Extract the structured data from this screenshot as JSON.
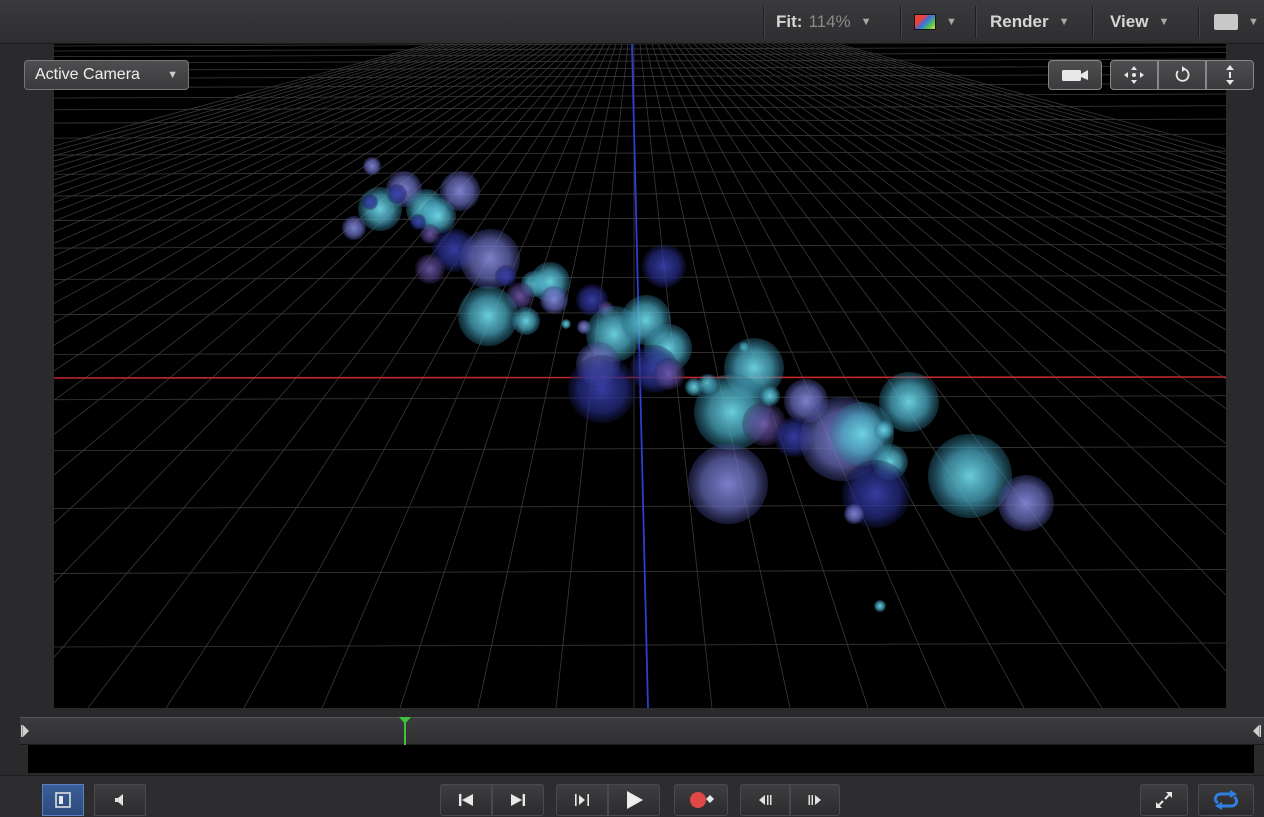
{
  "toolbar": {
    "fit_label": "Fit:",
    "fit_value": "114%",
    "render_label": "Render",
    "view_label": "View",
    "color_swatch_icon": "color-channels-icon",
    "layout_icon": "layout-icon"
  },
  "canvas": {
    "camera_select": "Active Camera",
    "camera_tools": [
      "camera-icon",
      "pan-icon",
      "orbit-icon",
      "dolly-icon"
    ],
    "axis_colors": {
      "x_axis": "#c0282a",
      "y_axis": "#2c3fd0",
      "grid": "#3a3a3a"
    },
    "particle_colors": [
      "#5fc3d4",
      "#7a7fd0",
      "#2a2f8f",
      "#6a5aa8"
    ]
  },
  "timeline": {
    "start_marker_icon": "play-range-start-icon",
    "end_marker_icon": "play-range-end-icon",
    "playhead_color": "#3ec23e"
  },
  "transport": {
    "buttons": [
      "show-hide-panel-icon",
      "audio-icon",
      "go-to-start-icon",
      "go-to-end-icon",
      "play-selection-icon",
      "play-icon",
      "record-icon",
      "previous-frame-icon",
      "next-frame-icon",
      "fullscreen-icon",
      "loop-icon"
    ],
    "accent_color": "#2f7fe0",
    "record_color": "#e04848"
  }
}
